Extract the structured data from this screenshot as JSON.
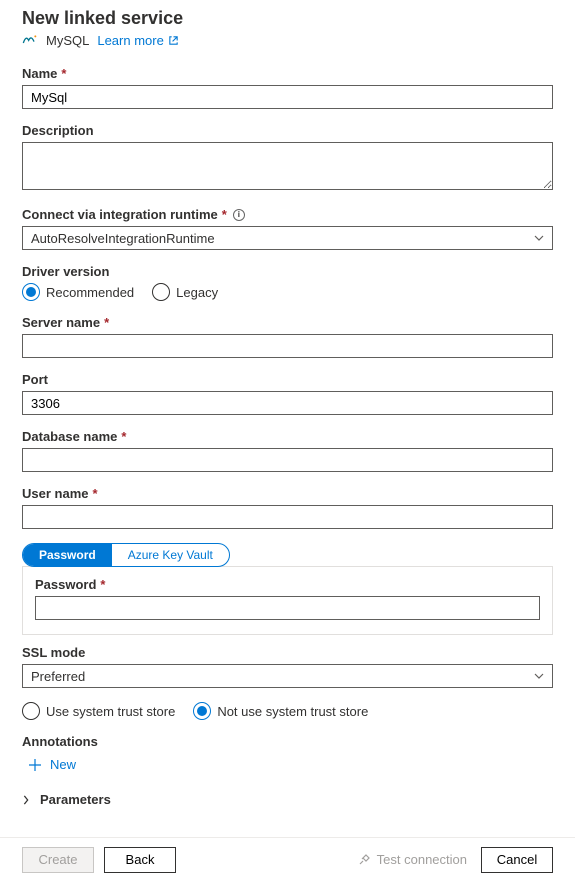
{
  "header": {
    "title": "New linked service",
    "service_name": "MySQL",
    "learn_more": "Learn more"
  },
  "fields": {
    "name": {
      "label": "Name",
      "value": "MySql"
    },
    "description": {
      "label": "Description",
      "value": ""
    },
    "integration_runtime": {
      "label": "Connect via integration runtime",
      "value": "AutoResolveIntegrationRuntime"
    },
    "driver_version": {
      "label": "Driver version",
      "options": {
        "a": "Recommended",
        "b": "Legacy"
      },
      "selected": "a"
    },
    "server_name": {
      "label": "Server name",
      "value": ""
    },
    "port": {
      "label": "Port",
      "value": "3306"
    },
    "database_name": {
      "label": "Database name",
      "value": ""
    },
    "user_name": {
      "label": "User name",
      "value": ""
    },
    "auth": {
      "tab_a": "Password",
      "tab_b": "Azure Key Vault",
      "password_label": "Password",
      "password_value": ""
    },
    "ssl_mode": {
      "label": "SSL mode",
      "value": "Preferred"
    },
    "trust_store": {
      "options": {
        "a": "Use system trust store",
        "b": "Not use system trust store"
      },
      "selected": "b"
    },
    "annotations": {
      "label": "Annotations",
      "add": "New"
    },
    "parameters": {
      "label": "Parameters"
    }
  },
  "footer": {
    "create": "Create",
    "back": "Back",
    "test": "Test connection",
    "cancel": "Cancel"
  }
}
